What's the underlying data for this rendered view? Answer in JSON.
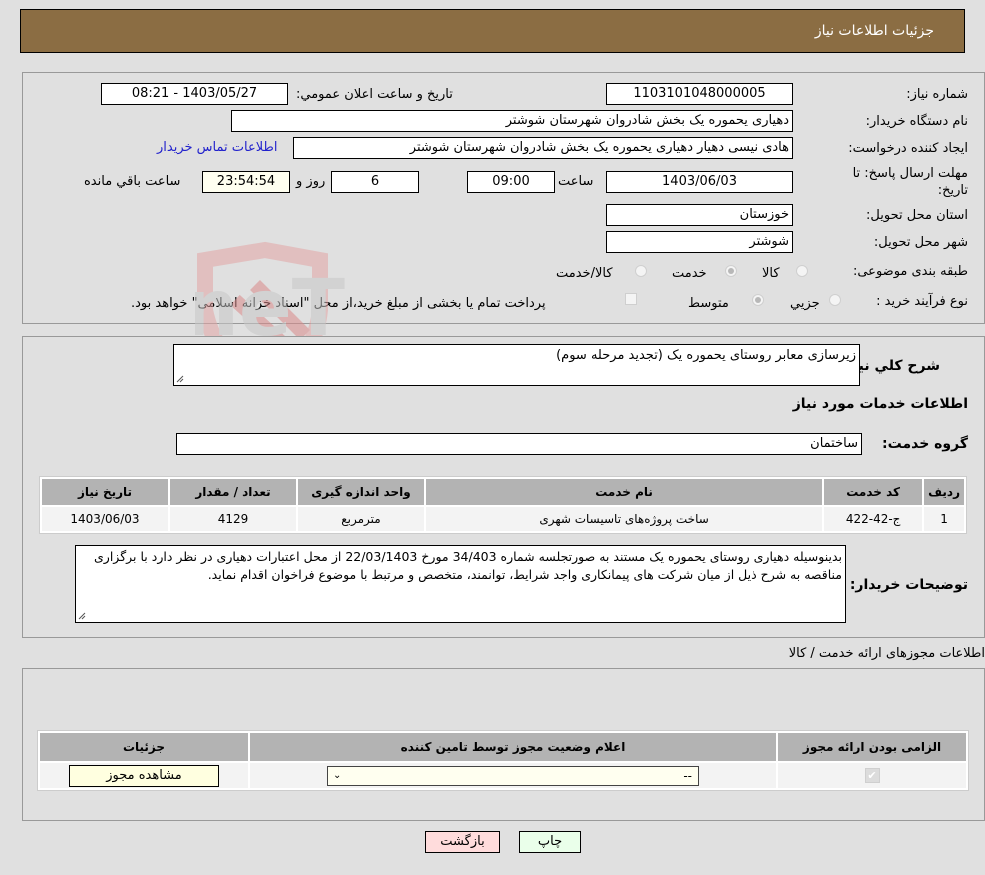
{
  "header": {
    "title": "جزئیات اطلاعات نیاز"
  },
  "form": {
    "need_number": {
      "label": "شماره نیاز:",
      "value": "1103101048000005"
    },
    "announce_datetime": {
      "label": "تاریخ و ساعت اعلان عمومي:",
      "value": "1403/05/27 - 08:21"
    },
    "buyer_org": {
      "label": "نام دستگاه خریدار:",
      "value": "دهیاری یحموره یک بخش شادروان شهرستان شوشتر"
    },
    "requester": {
      "label": "ایجاد کننده درخواست:",
      "value": "هادی نیسی دهیار دهیاری یحموره یک بخش شادروان شهرستان شوشتر",
      "contact_link": "اطلاعات تماس خریدار"
    },
    "deadline": {
      "label": "مهلت ارسال پاسخ: تا تاریخ:",
      "date": "1403/06/03",
      "time_label": "ساعت",
      "time": "09:00",
      "days": "6",
      "days_label": "روز و",
      "remaining": "23:54:54",
      "remaining_label": "ساعت باقي مانده"
    },
    "province": {
      "label": "استان محل تحویل:",
      "value": "خوزستان"
    },
    "city": {
      "label": "شهر محل تحویل:",
      "value": "شوشتر"
    },
    "category": {
      "label": "طبقه بندی موضوعی:",
      "options": [
        "کالا",
        "خدمت",
        "کالا/خدمت"
      ],
      "selected": "خدمت"
    },
    "purchase_type": {
      "label": "نوع فرآیند خرید :",
      "options": [
        "جزيي",
        "متوسط"
      ],
      "selected": "متوسط",
      "treasury_note": "پرداخت تمام یا بخشی از مبلغ خرید،از محل \"اسناد خزانه اسلامی\" خواهد بود."
    }
  },
  "description": {
    "label": "شرح کلي نياز:",
    "value": "زیرسازی معابر روستای یحموره یک (تجدید مرحله سوم)"
  },
  "services": {
    "section_title": "اطلاعات خدمات مورد نیاز",
    "group_label": "گروه خدمت:",
    "group_value": "ساختمان",
    "columns": [
      "ردیف",
      "کد خدمت",
      "نام خدمت",
      "واحد اندازه گیری",
      "تعداد / مقدار",
      "تاریخ نیاز"
    ],
    "rows": [
      {
        "index": "1",
        "code": "ج-42-422",
        "name": "ساخت پروژه‌های تاسیسات شهری",
        "unit": "مترمربع",
        "qty": "4129",
        "date": "1403/06/03"
      }
    ]
  },
  "buyer_notes": {
    "label": "توضیحات خریدار:",
    "value": "بدینوسیله دهیاری روستای یحموره یک مستند به صورتجلسه شماره 34/403 مورخ 22/03/1403 از محل اعتبارات دهیاری در نظر دارد با برگزاری مناقصه به شرح ذیل از میان شرکت های پیمانکاری واجد شرایط، توانمند، متخصص و مرتبط با موضوع فراخوان اقدام نماید."
  },
  "permits": {
    "section_title": "اطلاعات مجوزهای ارائه خدمت / کالا",
    "columns": [
      "الزامی بودن ارائه مجوز",
      "اعلام وضعیت مجوز توسط تامین کننده",
      "جزئیات"
    ],
    "row": {
      "required_checked": true,
      "status_value": "--",
      "details_button": "مشاهده مجوز"
    }
  },
  "buttons": {
    "print": "چاپ",
    "back": "بازگشت"
  },
  "watermark": {
    "text": "AriaTender.neT"
  },
  "colors": {
    "header_bg": "#8b6d43",
    "print_bg": "#eaffea",
    "back_bg": "#ffdcdc",
    "link": "#2222cc"
  }
}
